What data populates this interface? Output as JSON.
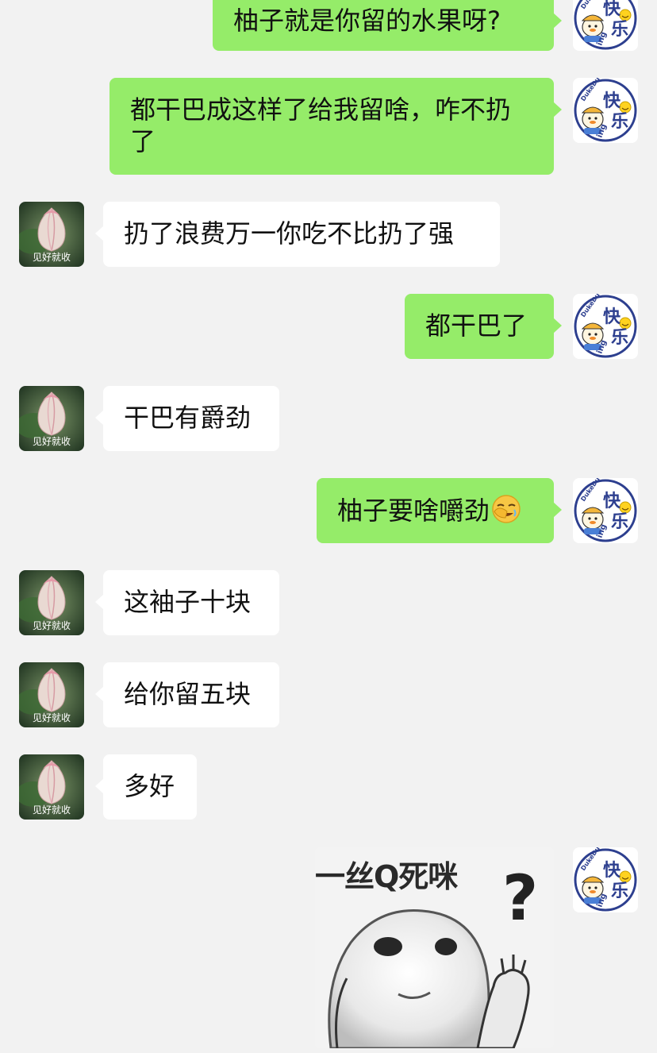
{
  "me_avatar": {
    "brand": "DukeDuck",
    "title": "快乐",
    "suffix": "ing"
  },
  "other_avatar": {
    "caption": "见好就收"
  },
  "messages": [
    {
      "side": "me",
      "text": "柚子就是你留的水果呀?"
    },
    {
      "side": "me",
      "text": "都干巴成这样了给我留啥，咋不扔了"
    },
    {
      "side": "other",
      "text": "扔了浪费万一你吃不比扔了强"
    },
    {
      "side": "me",
      "text": "都干巴了"
    },
    {
      "side": "other",
      "text": "干巴有爵劲"
    },
    {
      "side": "me",
      "text": "柚子要啥嚼劲"
    },
    {
      "side": "other",
      "text": "这袖子十块"
    },
    {
      "side": "other",
      "text": "给你留五块"
    },
    {
      "side": "other",
      "text": "多好"
    }
  ],
  "sticker": {
    "caption": "一丝Q死咪",
    "mark": "?"
  },
  "colors": {
    "me_bubble": "#95ec69",
    "other_bubble": "#ffffff",
    "background": "#f2f2f2"
  }
}
